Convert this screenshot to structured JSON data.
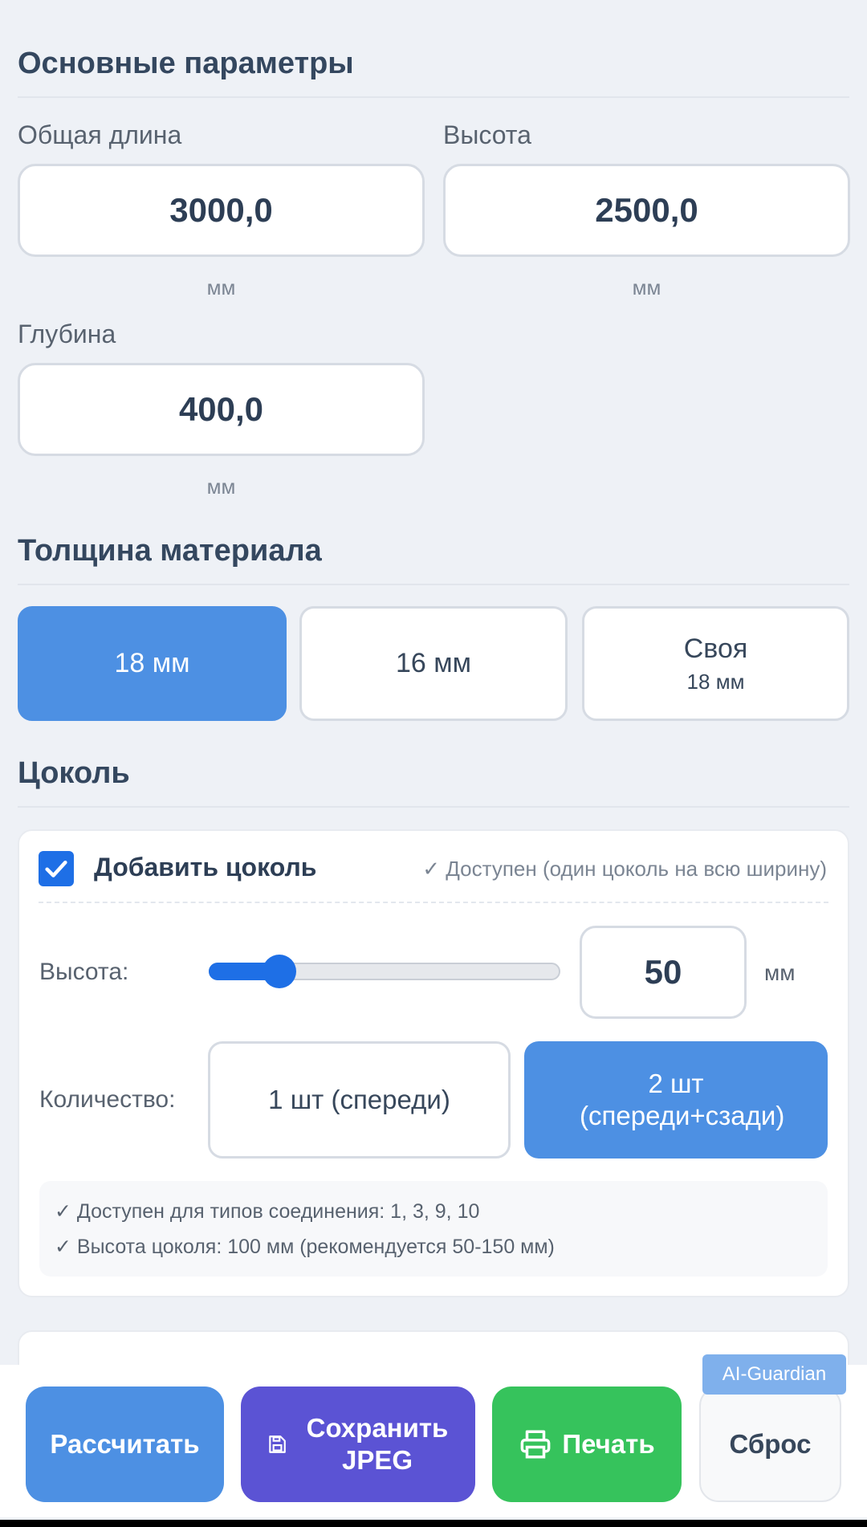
{
  "main_params": {
    "title": "Основные параметры",
    "length_label": "Общая длина",
    "length_value": "3000,0",
    "height_label": "Высота",
    "height_value": "2500,0",
    "depth_label": "Глубина",
    "depth_value": "400,0",
    "unit": "мм"
  },
  "thickness": {
    "title": "Толщина материала",
    "options": [
      {
        "label": "18 мм",
        "sub": "",
        "active": true
      },
      {
        "label": "16 мм",
        "sub": "",
        "active": false
      },
      {
        "label": "Своя",
        "sub": "18 мм",
        "active": false
      }
    ]
  },
  "plinth": {
    "title": "Цоколь",
    "checkbox_label": "Добавить цоколь",
    "checked": true,
    "availability": "✓ Доступен (один цоколь на всю ширину)",
    "height_label": "Высота:",
    "height_value": "50",
    "height_unit": "мм",
    "slider_level": 0.2,
    "qty_label": "Количество:",
    "qty_options": [
      "1 шт (спереди)",
      "2 шт (спереди+сзади)"
    ],
    "qty_selected": 1,
    "info_lines": [
      "✓ Доступен для типов соединения: 1, 3, 9, 10",
      "✓ Высота цоколя: 100 мм (рекомендуется 50-150 мм)"
    ]
  },
  "actions": {
    "calculate": "Рассчитать",
    "save_jpeg": "Сохранить JPEG",
    "print": "Печать",
    "reset": "Сброс",
    "badge": "AI-Guardian"
  },
  "colors": {
    "primary": "#4d90e3",
    "checkbox": "#1e6fe6",
    "jpeg": "#5b53d4",
    "print": "#36c35c"
  }
}
